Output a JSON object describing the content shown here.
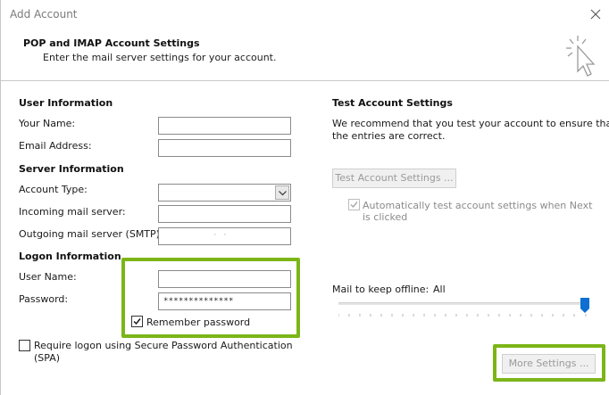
{
  "window": {
    "title": "Add Account"
  },
  "header": {
    "title": "POP and IMAP Account Settings",
    "subtitle": "Enter the mail server settings for your account."
  },
  "user_info": {
    "section": "User Information",
    "name_label": "Your Name:",
    "name_value": "",
    "email_label": "Email Address:",
    "email_value": ""
  },
  "server_info": {
    "section": "Server Information",
    "account_type_label": "Account Type:",
    "account_type_value": "",
    "incoming_label": "Incoming mail server:",
    "incoming_value": "",
    "outgoing_label": "Outgoing mail server (SMTP):",
    "outgoing_value": "·        ·"
  },
  "logon_info": {
    "section": "Logon Information",
    "username_label": "User Name:",
    "username_value": "",
    "password_label": "Password:",
    "password_value": "**************",
    "remember_label": "Remember password",
    "remember_checked": true,
    "spa_label_1": "Require logon using Secure Password Authentication",
    "spa_label_2": "(SPA)",
    "spa_checked": false
  },
  "test": {
    "section": "Test Account Settings",
    "desc_1": "We recommend that you test your account to ensure that",
    "desc_2": "the entries are correct.",
    "button": "Test Account Settings ...",
    "auto_label_1": "Automatically test account settings when Next",
    "auto_label_2": "is clicked",
    "auto_checked": true
  },
  "offline": {
    "label": "Mail to keep offline:",
    "value": "All",
    "slider_level": 1.0
  },
  "more_settings": {
    "button": "More Settings ..."
  },
  "colors": {
    "highlight": "#7cb518",
    "slider_thumb": "#0c6fd1"
  },
  "icons": {
    "close": "close-icon",
    "wizard": "wizard-cursor-icon",
    "dropdown": "chevron-down-icon",
    "check": "checkmark-icon"
  }
}
